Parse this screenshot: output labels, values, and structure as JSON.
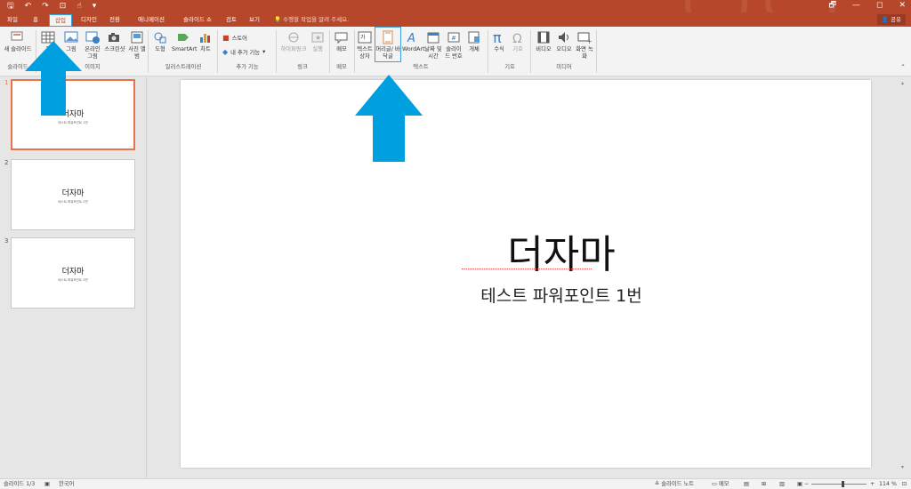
{
  "qat": {
    "save": "🖫",
    "undo": "↶",
    "redo": "↷",
    "present": "⊡",
    "touch": "☝",
    "more": "▾"
  },
  "window": {
    "restore": "🗗",
    "minimize": "—",
    "maximize": "◻",
    "close": "✕"
  },
  "tabs": [
    {
      "label": "파일"
    },
    {
      "label": "홈"
    },
    {
      "label": "삽입"
    },
    {
      "label": "디자인"
    },
    {
      "label": "전환"
    },
    {
      "label": "애니메이션"
    },
    {
      "label": "슬라이드 쇼"
    },
    {
      "label": "검토"
    },
    {
      "label": "보기"
    }
  ],
  "tell_me": "수행할 작업을 알려 주세요.",
  "share": "공유",
  "ribbon": {
    "new_slide": "새 슬라이드",
    "table": "표",
    "images": "그림",
    "online_images": "온라인 그림",
    "screenshot": "스크린샷",
    "photo_album": "사진 앨범",
    "shapes": "도형",
    "smartart": "SmartArt",
    "chart": "차트",
    "store": "스토어",
    "my_addins": "내 추가 기능",
    "hyperlink": "하이퍼링크",
    "action": "실행",
    "comment": "메모",
    "textbox": "텍스트 상자",
    "header_footer": "머리글/ 바닥글",
    "wordart": "WordArt",
    "datetime": "날짜 및 시간",
    "slide_number": "슬라이 드 번호",
    "object": "개체",
    "equation": "수식",
    "symbol": "기호",
    "video": "비디오",
    "audio": "오디오",
    "screen_recording": "화면 녹화",
    "groups": {
      "slides": "슬라이드",
      "images": "이미지",
      "illustrations": "일러스트레이션",
      "addins": "추가 기능",
      "links": "링크",
      "comments": "메모",
      "text": "텍스트",
      "symbols": "기호",
      "media": "미디어"
    }
  },
  "slides": [
    {
      "num": "1",
      "title": "더자마",
      "subtitle": "테스트 파워포인트 1번"
    },
    {
      "num": "2",
      "title": "더자마",
      "subtitle": "테스트 파워포인트 2번"
    },
    {
      "num": "3",
      "title": "더자마",
      "subtitle": "테스트 파워포인트 3번"
    }
  ],
  "current_slide": {
    "title": "더자마",
    "subtitle": "테스트 파워포인트 1번"
  },
  "status": {
    "slide_count": "슬라이드 1/3",
    "language": "한국어",
    "notes": "슬라이드 노트",
    "comments": "메모",
    "zoom": "114 %"
  },
  "colors": {
    "accent": "#b7472a",
    "highlight": "#3aa0db",
    "arrow": "#00a0e0",
    "selected_thumb": "#e8734a"
  }
}
